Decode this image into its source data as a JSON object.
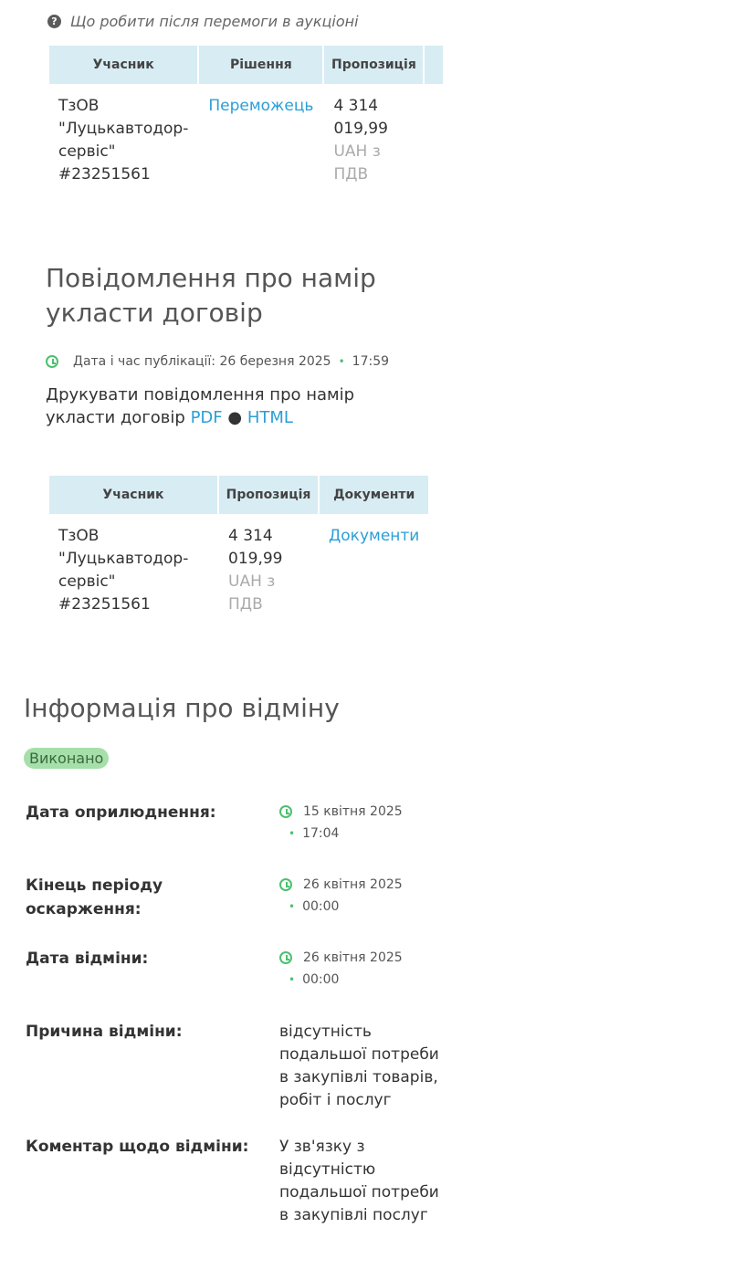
{
  "help": {
    "icon": "question-circle-icon",
    "text": "Що робити після перемоги в аукціоні"
  },
  "auction_table": {
    "headers": [
      "Учасник",
      "Рішення",
      "Пропозиція"
    ],
    "row": {
      "participant": "ТзОВ \"Луцькавтодор-сервіс\" #23251561",
      "decision": "Переможець",
      "amount": "4 314 019,99",
      "currency": "UAH з ПДВ"
    }
  },
  "intent": {
    "title": "Повідомлення про намір укласти договір",
    "pub_label": "Дата і час публікації: 26 березня 2025",
    "pub_time": "17:59",
    "print_text": "Друкувати повідомлення про намір укласти договір",
    "pdf_link": "PDF",
    "separator": "●",
    "html_link": "HTML"
  },
  "intent_table": {
    "headers": [
      "Учасник",
      "Пропозиція",
      "Документи"
    ],
    "row": {
      "participant": "ТзОВ \"Луцькавтодор-сервіс\" #23251561",
      "amount": "4 314 019,99",
      "currency": "UAH з ПДВ",
      "documents": "Документи"
    }
  },
  "cancel": {
    "title": "Інформація про відміну",
    "status": "Виконано",
    "fields": [
      {
        "label": "Дата оприлюднення:",
        "date": "15 квітня 2025",
        "time": "17:04"
      },
      {
        "label": "Кінець періоду оскарження:",
        "date": "26 квітня 2025",
        "time": "00:00"
      },
      {
        "label": "Дата відміни:",
        "date": "26 квітня 2025",
        "time": "00:00"
      }
    ],
    "reason_label": "Причина відміни:",
    "reason_value": "відсутність подальшої потреби в закупівлі товарів, робіт і послуг",
    "comment_label": "Коментар щодо відміни:",
    "comment_value": "У зв'язку з відсутністю подальшої потреби в закупівлі послуг"
  },
  "colors": {
    "accent": "#2a9fd6",
    "header_bg": "#d8ecf3",
    "green": "#4cc06e",
    "badge": "#a6dfa9"
  }
}
